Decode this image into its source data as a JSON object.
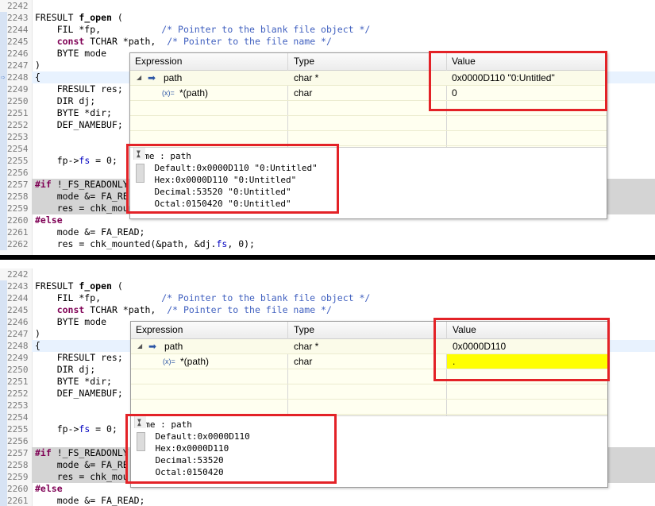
{
  "top": {
    "lines": [
      {
        "n": "2242",
        "t": ""
      },
      {
        "n": "2243",
        "t": "FRESULT f_open ("
      },
      {
        "n": "2244",
        "t": "    FIL *fp,           /* Pointer to the blank file object */"
      },
      {
        "n": "2245",
        "t": "    const TCHAR *path,  /* Pointer to the file name */"
      },
      {
        "n": "2246",
        "t": "    BYTE mode"
      },
      {
        "n": "2247",
        "t": ")"
      },
      {
        "n": "2248",
        "t": "{"
      },
      {
        "n": "2249",
        "t": "    FRESULT res;"
      },
      {
        "n": "2250",
        "t": "    DIR dj;"
      },
      {
        "n": "2251",
        "t": "    BYTE *dir;"
      },
      {
        "n": "2252",
        "t": "    DEF_NAMEBUF;"
      },
      {
        "n": "2253",
        "t": ""
      },
      {
        "n": "2254",
        "t": ""
      },
      {
        "n": "2255",
        "t": "    fp->fs = 0;"
      },
      {
        "n": "2256",
        "t": ""
      },
      {
        "n": "2257",
        "t": "#if !_FS_READONLY"
      },
      {
        "n": "2258",
        "t": "    mode &= FA_RE"
      },
      {
        "n": "2259",
        "t": "    res = chk_mount"
      },
      {
        "n": "2260",
        "t": "#else"
      },
      {
        "n": "2261",
        "t": "    mode &= FA_READ;"
      },
      {
        "n": "2262",
        "t": "    res = chk_mounted(&path, &dj.fs, 0);"
      }
    ],
    "popup": {
      "headers": {
        "expression": "Expression",
        "type": "Type",
        "value": "Value"
      },
      "rows": [
        {
          "expr": "path",
          "type": "char *",
          "value": "0x0000D110 \"0:Untitled\""
        },
        {
          "expr": "*(path)",
          "type": "char",
          "value": "0"
        }
      ],
      "details": [
        "Name : path",
        "    Default:0x0000D110 \"0:Untitled\"",
        "    Hex:0x0000D110 \"0:Untitled\"",
        "    Decimal:53520 \"0:Untitled\"",
        "    Octal:0150420 \"0:Untitled\""
      ]
    }
  },
  "bottom": {
    "lines": [
      {
        "n": "2242",
        "t": ""
      },
      {
        "n": "2243",
        "t": "FRESULT f_open ("
      },
      {
        "n": "2244",
        "t": "    FIL *fp,           /* Pointer to the blank file object */"
      },
      {
        "n": "2245",
        "t": "    const TCHAR *path,  /* Pointer to the file name */"
      },
      {
        "n": "2246",
        "t": "    BYTE mode"
      },
      {
        "n": "2247",
        "t": ")"
      },
      {
        "n": "2248",
        "t": "{"
      },
      {
        "n": "2249",
        "t": "    FRESULT res;"
      },
      {
        "n": "2250",
        "t": "    DIR dj;"
      },
      {
        "n": "2251",
        "t": "    BYTE *dir;"
      },
      {
        "n": "2252",
        "t": "    DEF_NAMEBUF;"
      },
      {
        "n": "2253",
        "t": ""
      },
      {
        "n": "2254",
        "t": ""
      },
      {
        "n": "2255",
        "t": "    fp->fs = 0;"
      },
      {
        "n": "2256",
        "t": ""
      },
      {
        "n": "2257",
        "t": "#if !_FS_READONLY"
      },
      {
        "n": "2258",
        "t": "    mode &= FA_RE"
      },
      {
        "n": "2259",
        "t": "    res = chk_mou"
      },
      {
        "n": "2260",
        "t": "#else"
      },
      {
        "n": "2261",
        "t": "    mode &= FA_READ;"
      }
    ],
    "popup": {
      "headers": {
        "expression": "Expression",
        "type": "Type",
        "value": "Value"
      },
      "rows": [
        {
          "expr": "path",
          "type": "char *",
          "value": "0x0000D110"
        },
        {
          "expr": "*(path)",
          "type": "char",
          "value": "."
        }
      ],
      "details": [
        "Name : path",
        "    Default:0x0000D110",
        "    Hex:0x0000D110",
        "    Decimal:53520",
        "    Octal:0150420"
      ]
    }
  },
  "icons": {
    "expand": "expand-triangle-icon",
    "pointer": "pointer-arrow-icon",
    "expression": "x-equals-expression-icon",
    "debug_marker": "current-line-marker-icon"
  },
  "colors": {
    "highlight_box": "#e32227",
    "changed_value": "#ffff00",
    "popup_bg": "#fffff0"
  }
}
